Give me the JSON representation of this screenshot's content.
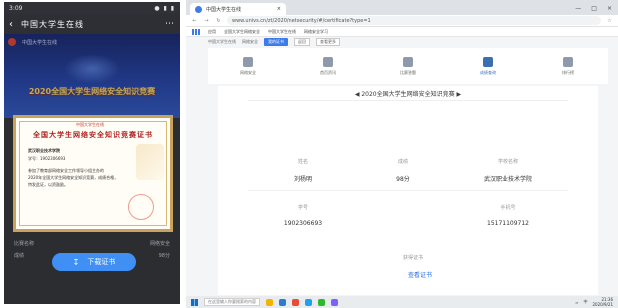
{
  "phone": {
    "status_time": "3:09",
    "status_icons": "● ▮ ▮",
    "nav_title": "中国大学生在线",
    "banner_site": "中国大学生在线",
    "banner_heading": "2020全国大学生网络安全知识竞赛",
    "certificate": {
      "logo_text": "中国大学生在线",
      "title": "全国大学生网络安全知识竞赛证书",
      "school_line": "武汉职业技术学院",
      "student_id_line": "学号：1902306693",
      "body_line_1": "参加了教育部网络安全工作领导小组主办的",
      "body_line_2": "2020年全国大学生网络安全知识竞赛，成绩合格，",
      "body_line_3": "特发此证，以资鼓励。"
    },
    "rows": [
      {
        "label": "比赛名称",
        "value": "网络安全"
      },
      {
        "label": "成绩",
        "value": "98分"
      }
    ],
    "download_label": "下载证书",
    "download_icon": "download-arrow"
  },
  "browser": {
    "tab_title": "中国大学生在线",
    "url": "www.univs.cn/zt/2020/netsecurity/#/certificate?type=1",
    "bookmarks": [
      "应用",
      "全国大学生网络安全",
      "中国大学生在线",
      "网络安全学习"
    ]
  },
  "site": {
    "crumbs": [
      "中国大学生在线",
      "网络安全",
      "我的证书",
      "返回",
      "查看更多"
    ],
    "nav": [
      {
        "label": "网络安全",
        "icon": "book-icon"
      },
      {
        "label": "首页资讯",
        "icon": "home-icon"
      },
      {
        "label": "比赛答题",
        "icon": "trophy-icon"
      },
      {
        "label": "成绩查询",
        "icon": "document-icon"
      },
      {
        "label": "排行榜",
        "icon": "chart-icon"
      }
    ],
    "panel_title": "2020全国大学生网络安全知识竞赛",
    "fields": {
      "name_label": "姓名",
      "name_value": "刘杨明",
      "score_label": "成绩",
      "score_value": "98分",
      "school_label": "学校名称",
      "school_value": "武汉职业技术学院",
      "id_label": "学号",
      "id_value": "1902306693",
      "phone_label": "手机号",
      "phone_value": "15171109712",
      "cert_label": "获得证书"
    },
    "cert_link": "查看证书"
  },
  "taskbar": {
    "search_placeholder": "在这里输入你要搜索的内容",
    "time": "21:36",
    "date": "2020/9/21",
    "lang": "中"
  },
  "colors": {
    "accent": "#3c7be8",
    "certificate_border": "#c9a35a",
    "download_button": "#3f8ff5"
  }
}
